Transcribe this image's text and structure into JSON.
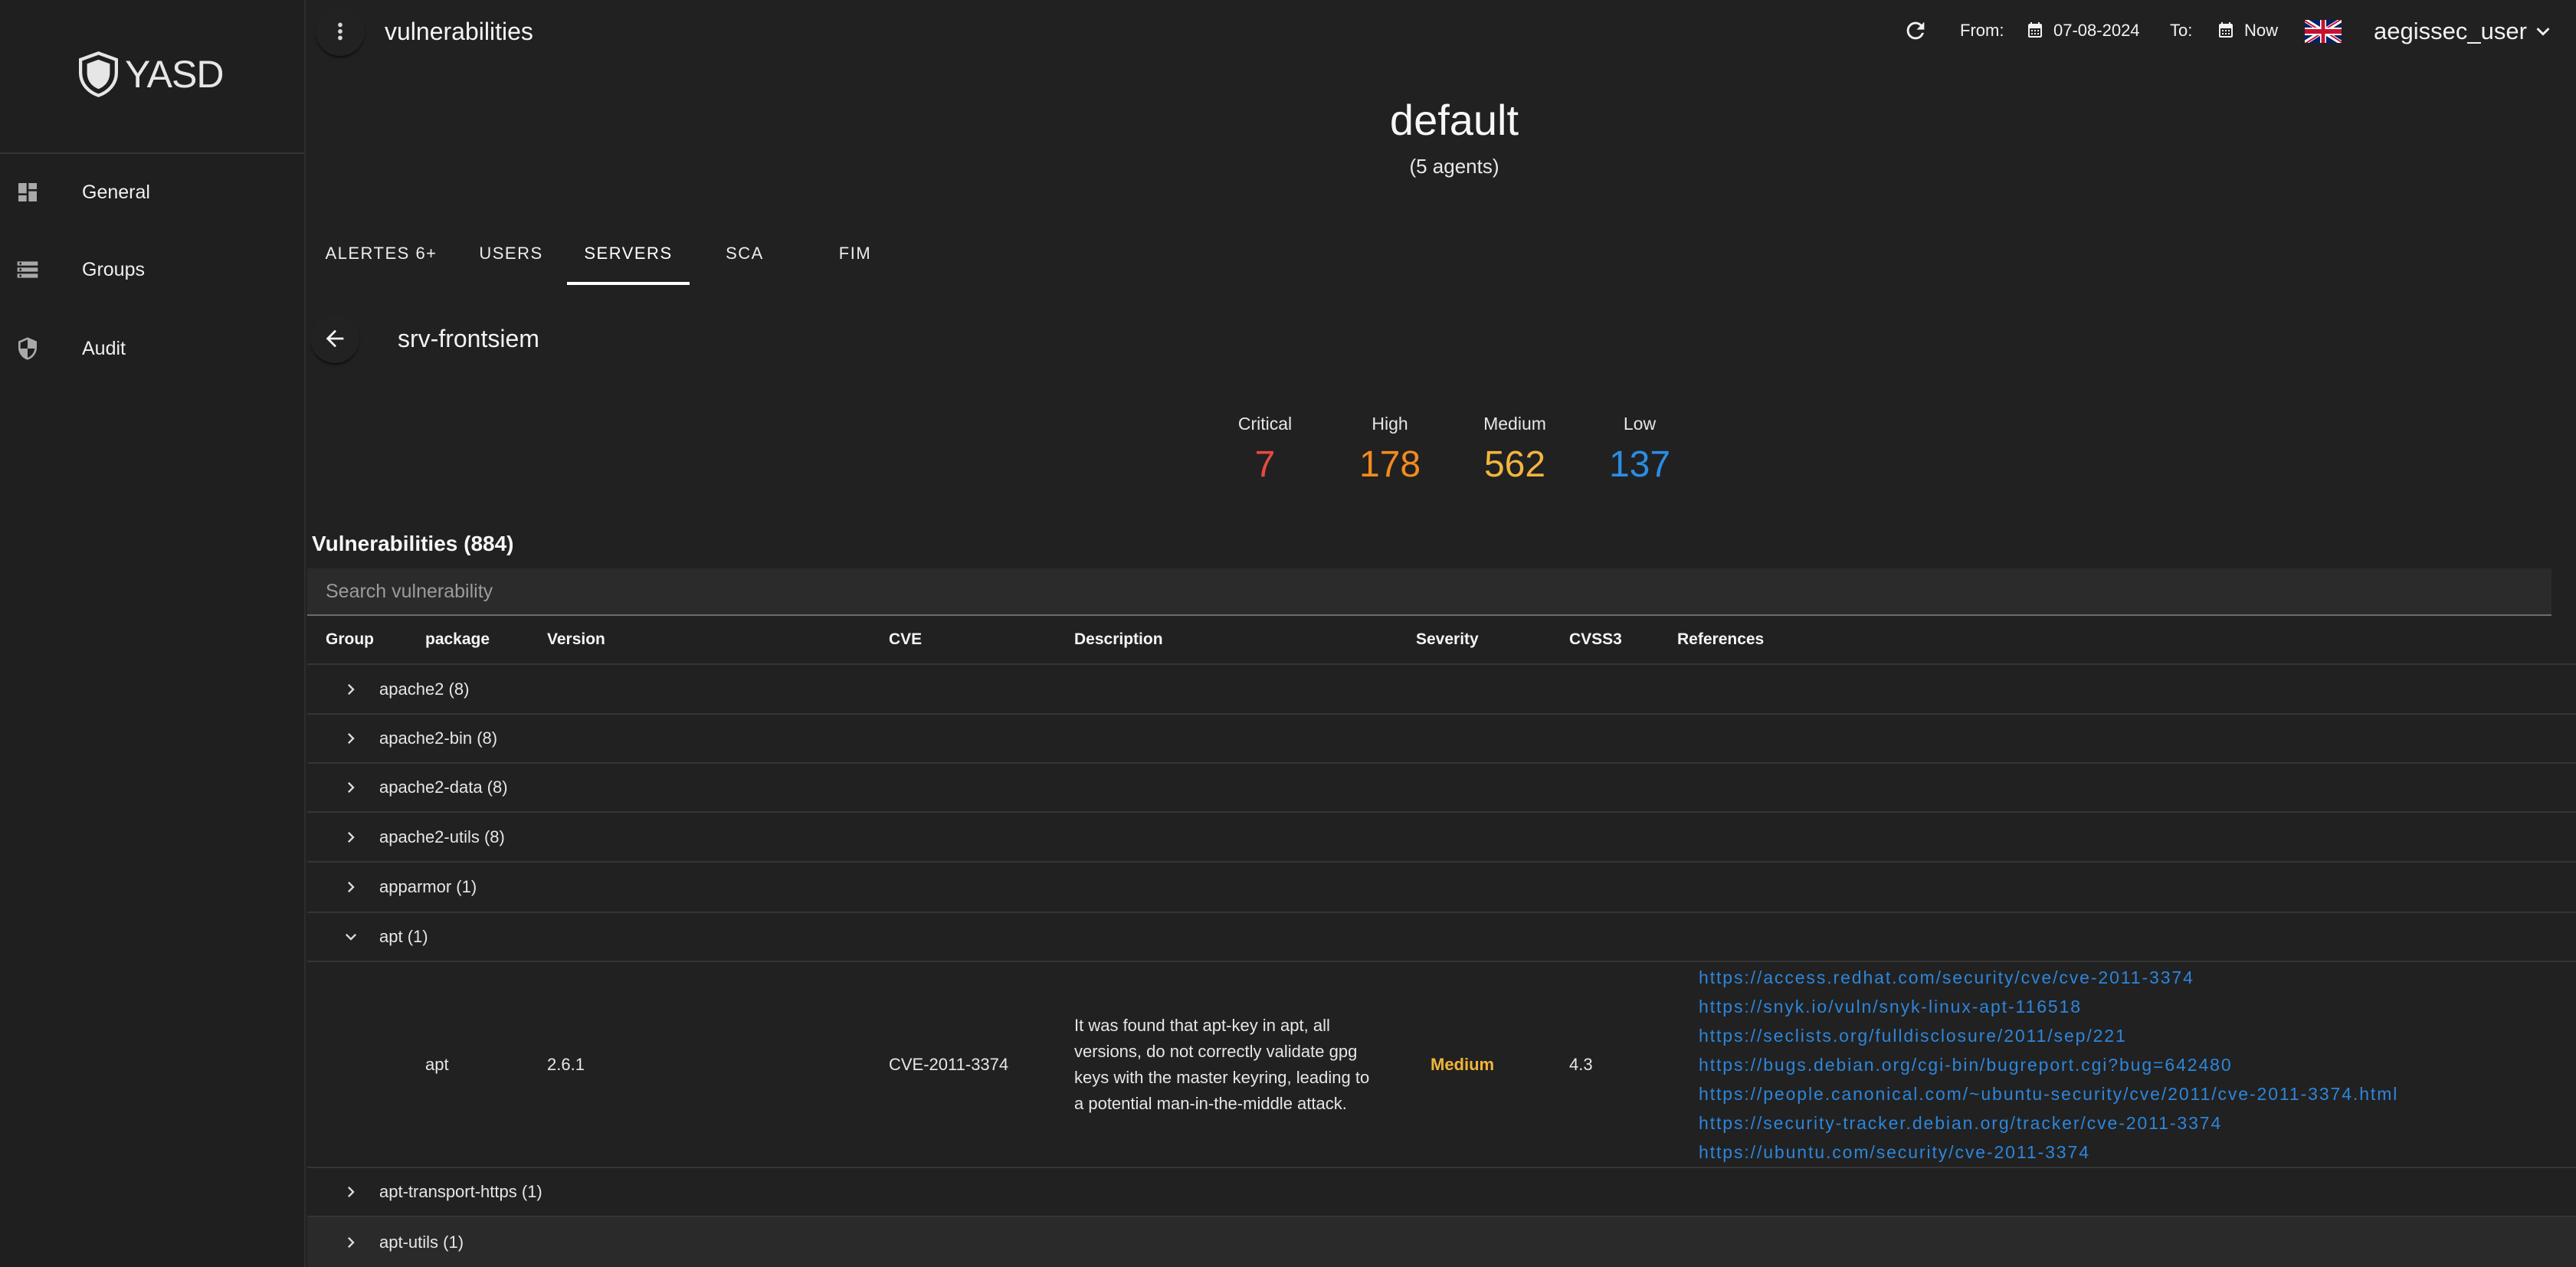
{
  "app": {
    "name": "YASD",
    "logo_icon": "shield-logo-icon"
  },
  "sidebar": {
    "items": [
      {
        "label": "General",
        "icon": "dashboard-icon"
      },
      {
        "label": "Groups",
        "icon": "storage-icon"
      },
      {
        "label": "Audit",
        "icon": "security-shield-icon"
      }
    ]
  },
  "topbar": {
    "title": "vulnerabilities",
    "from_label": "From:",
    "from_date": "07-08-2024",
    "to_label": "To:",
    "to_date": "Now",
    "language_flag": "uk-flag-icon",
    "user": "aegissec_user"
  },
  "group": {
    "name": "default",
    "agents": "(5 agents)"
  },
  "tabs": [
    {
      "label": "ALERTES 6+",
      "active": false
    },
    {
      "label": "USERS",
      "active": false
    },
    {
      "label": "SERVERS",
      "active": true
    },
    {
      "label": "SCA",
      "active": false
    },
    {
      "label": "FIM",
      "active": false
    }
  ],
  "server": {
    "name": "srv-frontsiem"
  },
  "severity_summary": [
    {
      "label": "Critical",
      "value": "7",
      "color": "#e84a3f"
    },
    {
      "label": "High",
      "value": "178",
      "color": "#f28b1e"
    },
    {
      "label": "Medium",
      "value": "562",
      "color": "#f3b53d"
    },
    {
      "label": "Low",
      "value": "137",
      "color": "#2b8de4"
    }
  ],
  "vulnerabilities": {
    "title": "Vulnerabilities (884)",
    "search_placeholder": "Search vulnerability",
    "columns": [
      "Group",
      "package",
      "Version",
      "CVE",
      "Description",
      "Severity",
      "CVSS3",
      "References"
    ],
    "groups": [
      {
        "label": "apache2 (8)",
        "expanded": false
      },
      {
        "label": "apache2-bin (8)",
        "expanded": false
      },
      {
        "label": "apache2-data (8)",
        "expanded": false
      },
      {
        "label": "apache2-utils (8)",
        "expanded": false
      },
      {
        "label": "apparmor (1)",
        "expanded": false
      },
      {
        "label": "apt (1)",
        "expanded": true
      },
      {
        "label": "apt-transport-https (1)",
        "expanded": false
      },
      {
        "label": "apt-utils (1)",
        "expanded": false
      }
    ],
    "expanded_row": {
      "package": "apt",
      "version": "2.6.1",
      "cve": "CVE-2011-3374",
      "description": "It was found that apt-key in apt, all versions, do not correctly validate gpg keys with the master keyring, leading to a potential man-in-the-middle attack.",
      "severity": "Medium",
      "severity_color": "#f0b43a",
      "cvss3": "4.3",
      "link_color": "#2d86dc",
      "references": [
        "https://access.redhat.com/security/cve/cve-2011-3374",
        "https://snyk.io/vuln/snyk-linux-apt-116518",
        "https://seclists.org/fulldisclosure/2011/sep/221",
        "https://bugs.debian.org/cgi-bin/bugreport.cgi?bug=642480",
        "https://people.canonical.com/~ubuntu-security/cve/2011/cve-2011-3374.html",
        "https://security-tracker.debian.org/tracker/cve-2011-3374",
        "https://ubuntu.com/security/cve-2011-3374"
      ]
    }
  }
}
